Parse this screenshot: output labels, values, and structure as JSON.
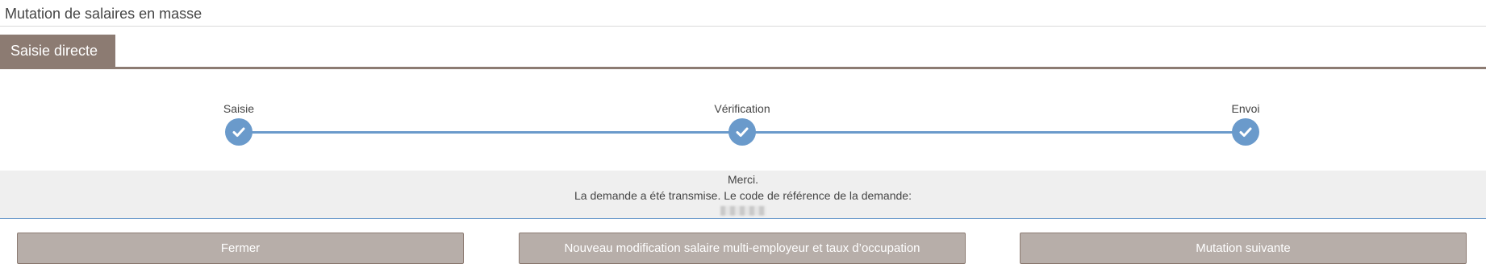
{
  "header": {
    "title": "Mutation de salaires en masse"
  },
  "tabs": [
    {
      "label": "Saisie directe",
      "active": true
    }
  ],
  "steps": [
    {
      "label": "Saisie",
      "status": "done",
      "icon": "check-icon"
    },
    {
      "label": "Vérification",
      "status": "done",
      "icon": "check-icon"
    },
    {
      "label": "Envoi",
      "status": "done",
      "icon": "check-icon"
    }
  ],
  "message": {
    "line1": "Merci.",
    "line2": "La demande a été transmise. Le code de référence de la demande:"
  },
  "buttons": {
    "close": "Fermer",
    "new_modification": "Nouveau modification salaire multi-employeur et taux d’occupation",
    "next_mutation": "Mutation suivante"
  },
  "colors": {
    "brand": "#8c7b72",
    "button_bg": "#b7aea9",
    "step_accent": "#6a9acb",
    "message_bg": "#efefef"
  }
}
